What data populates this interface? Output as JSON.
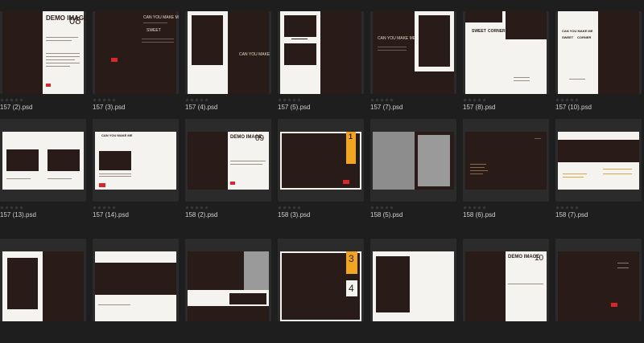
{
  "files": [
    {
      "label": "157 (2).psd"
    },
    {
      "label": "157 (3).psd"
    },
    {
      "label": "157 (4).psd"
    },
    {
      "label": "157 (5).psd"
    },
    {
      "label": "157 (7).psd"
    },
    {
      "label": "157 (8).psd"
    },
    {
      "label": "157 (10).psd"
    },
    {
      "label": "157 (13).psd"
    },
    {
      "label": "157 (14).psd"
    },
    {
      "label": "158 (2).psd"
    },
    {
      "label": "158 (3).psd"
    },
    {
      "label": "158 (5).psd"
    },
    {
      "label": "158 (6).psd"
    },
    {
      "label": "158 (7).psd"
    }
  ],
  "thumbnail_text": {
    "demo_image_1": "DEMO IMAGE",
    "number_08": "08",
    "number_09": "09",
    "number_10": "10",
    "number_1": "1",
    "number_3": "3",
    "number_4": "4",
    "can_you": "CAN YOU MAKE ME",
    "sweet": "SWEET",
    "corner": "CORNER"
  },
  "rating_stars": 5,
  "colors": {
    "background": "#1e1e1e",
    "tile": "#2b2b2b",
    "page_dark": "#291b17",
    "page_white": "#f4f3f0",
    "accent_orange": "#f2a521",
    "accent_red": "#d8262a"
  }
}
